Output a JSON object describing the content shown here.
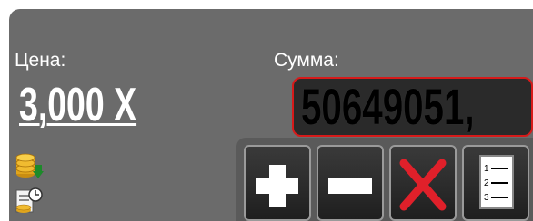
{
  "price": {
    "label": "Цена:",
    "value": "3,000 X"
  },
  "sum": {
    "label": "Сумма:",
    "value": "50649051,"
  },
  "buttons": [
    {
      "icon": "plus-icon"
    },
    {
      "icon": "minus-icon"
    },
    {
      "icon": "cross-icon"
    },
    {
      "icon": "list-icon"
    }
  ],
  "side_icons": [
    "coins-down-icon",
    "report-clock-icon"
  ],
  "colors": {
    "panel": "#6b6b6b",
    "sum_border": "#d61a1a",
    "cross": "#e0202a",
    "text": "#ffffff"
  }
}
